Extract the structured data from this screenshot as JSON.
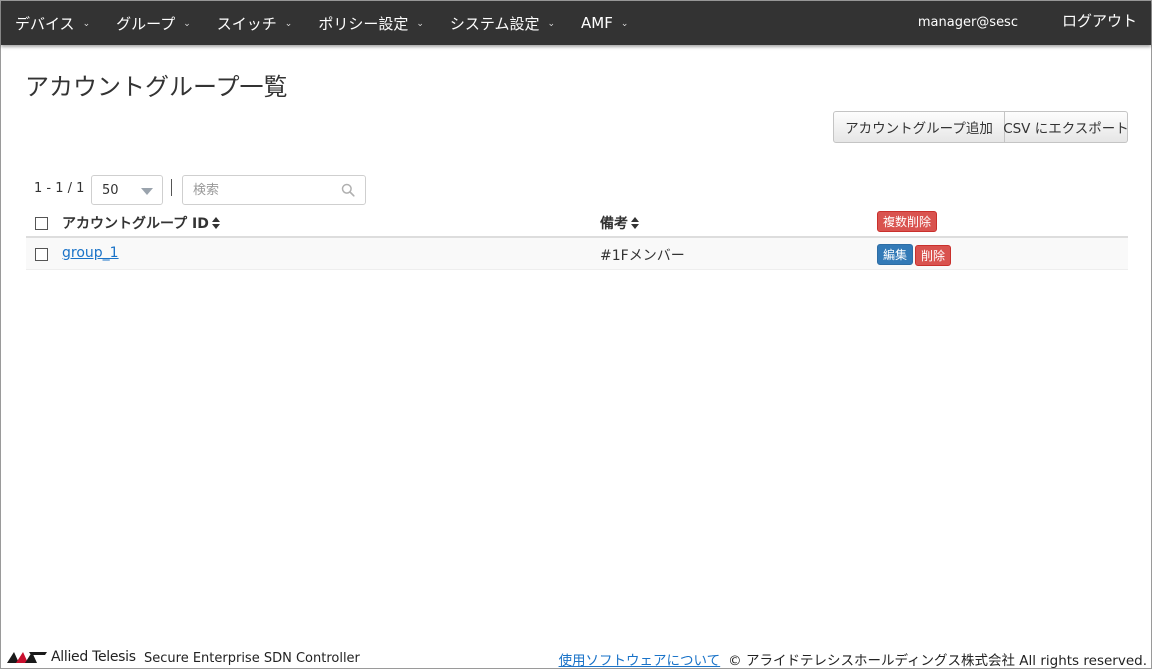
{
  "nav": {
    "items": [
      {
        "label": "デバイス"
      },
      {
        "label": "グループ"
      },
      {
        "label": "スイッチ"
      },
      {
        "label": "ポリシー設定"
      },
      {
        "label": "システム設定"
      },
      {
        "label": "AMF"
      }
    ],
    "user": "manager@sesc",
    "logout": "ログアウト"
  },
  "page": {
    "title": "アカウントグループ一覧"
  },
  "actions": {
    "add_label": "アカウントグループ追加",
    "export_label": "CSV にエクスポート"
  },
  "toolbar": {
    "range": "1 - 1 / 1",
    "per_page": "50",
    "search_placeholder": "検索"
  },
  "table": {
    "columns": {
      "id": "アカウントグループ ID",
      "note": "備考"
    },
    "bulk_delete_label": "複数削除",
    "rows": [
      {
        "id": "group_1",
        "note": "#1Fメンバー",
        "edit_label": "編集",
        "delete_label": "削除"
      }
    ]
  },
  "footer": {
    "brand": "Allied Telesis",
    "product": "Secure Enterprise SDN Controller",
    "about_link": "使用ソフトウェアについて",
    "copyright": "© アライドテレシスホールディングス株式会社 All rights reserved."
  },
  "colors": {
    "navbar": "#333333",
    "link": "#1a73c8",
    "danger": "#d9534f",
    "primary": "#337ab7"
  }
}
